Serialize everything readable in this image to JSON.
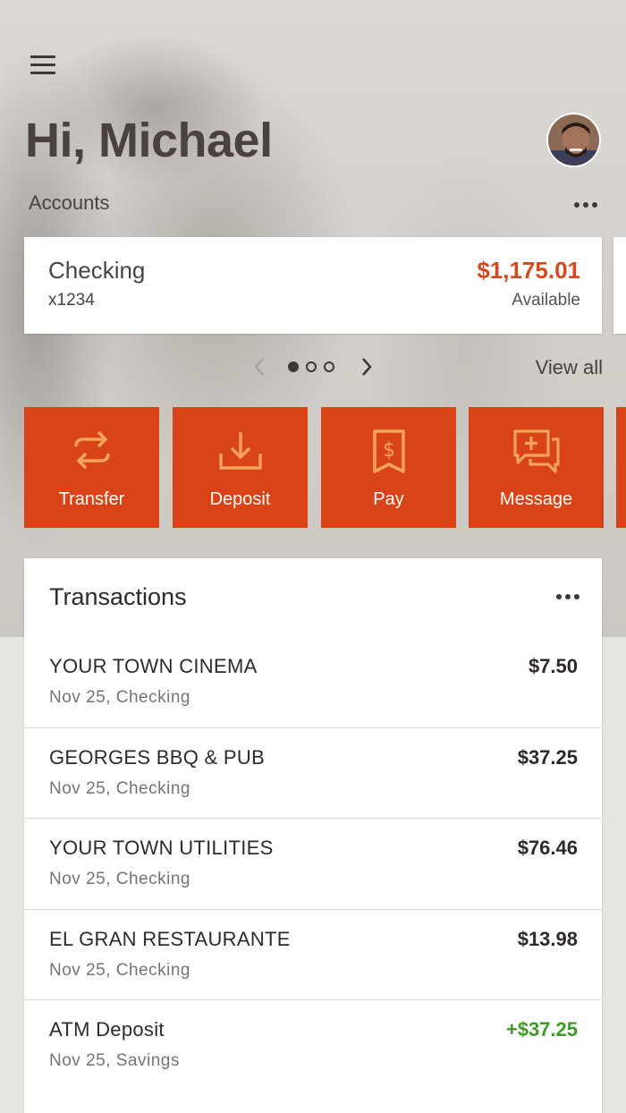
{
  "header": {
    "greeting": "Hi, Michael",
    "accounts_label": "Accounts"
  },
  "account": {
    "name": "Checking",
    "number": "x1234",
    "balance": "$1,175.01",
    "balance_label": "Available"
  },
  "pager": {
    "pages": 3,
    "current": 1,
    "view_all": "View all"
  },
  "actions": [
    {
      "label": "Transfer",
      "icon": "transfer-icon"
    },
    {
      "label": "Deposit",
      "icon": "deposit-icon"
    },
    {
      "label": "Pay",
      "icon": "receipt-icon"
    },
    {
      "label": "Message",
      "icon": "message-icon"
    }
  ],
  "transactions": {
    "title": "Transactions",
    "items": [
      {
        "merchant": "YOUR TOWN CINEMA",
        "sub": "Nov 25, Checking",
        "amount": "$7.50",
        "credit": false
      },
      {
        "merchant": "GEORGES BBQ & PUB",
        "sub": "Nov 25, Checking",
        "amount": "$37.25",
        "credit": false
      },
      {
        "merchant": "YOUR TOWN UTILITIES",
        "sub": "Nov 25, Checking",
        "amount": "$76.46",
        "credit": false
      },
      {
        "merchant": "EL GRAN RESTAURANTE",
        "sub": "Nov 25, Checking",
        "amount": "$13.98",
        "credit": false
      },
      {
        "merchant": "ATM Deposit",
        "sub": "Nov 25, Savings",
        "amount": "+$37.25",
        "credit": true
      }
    ]
  },
  "colors": {
    "accent": "#d84317",
    "balance": "#d24a1e",
    "credit": "#3e9b2a"
  }
}
